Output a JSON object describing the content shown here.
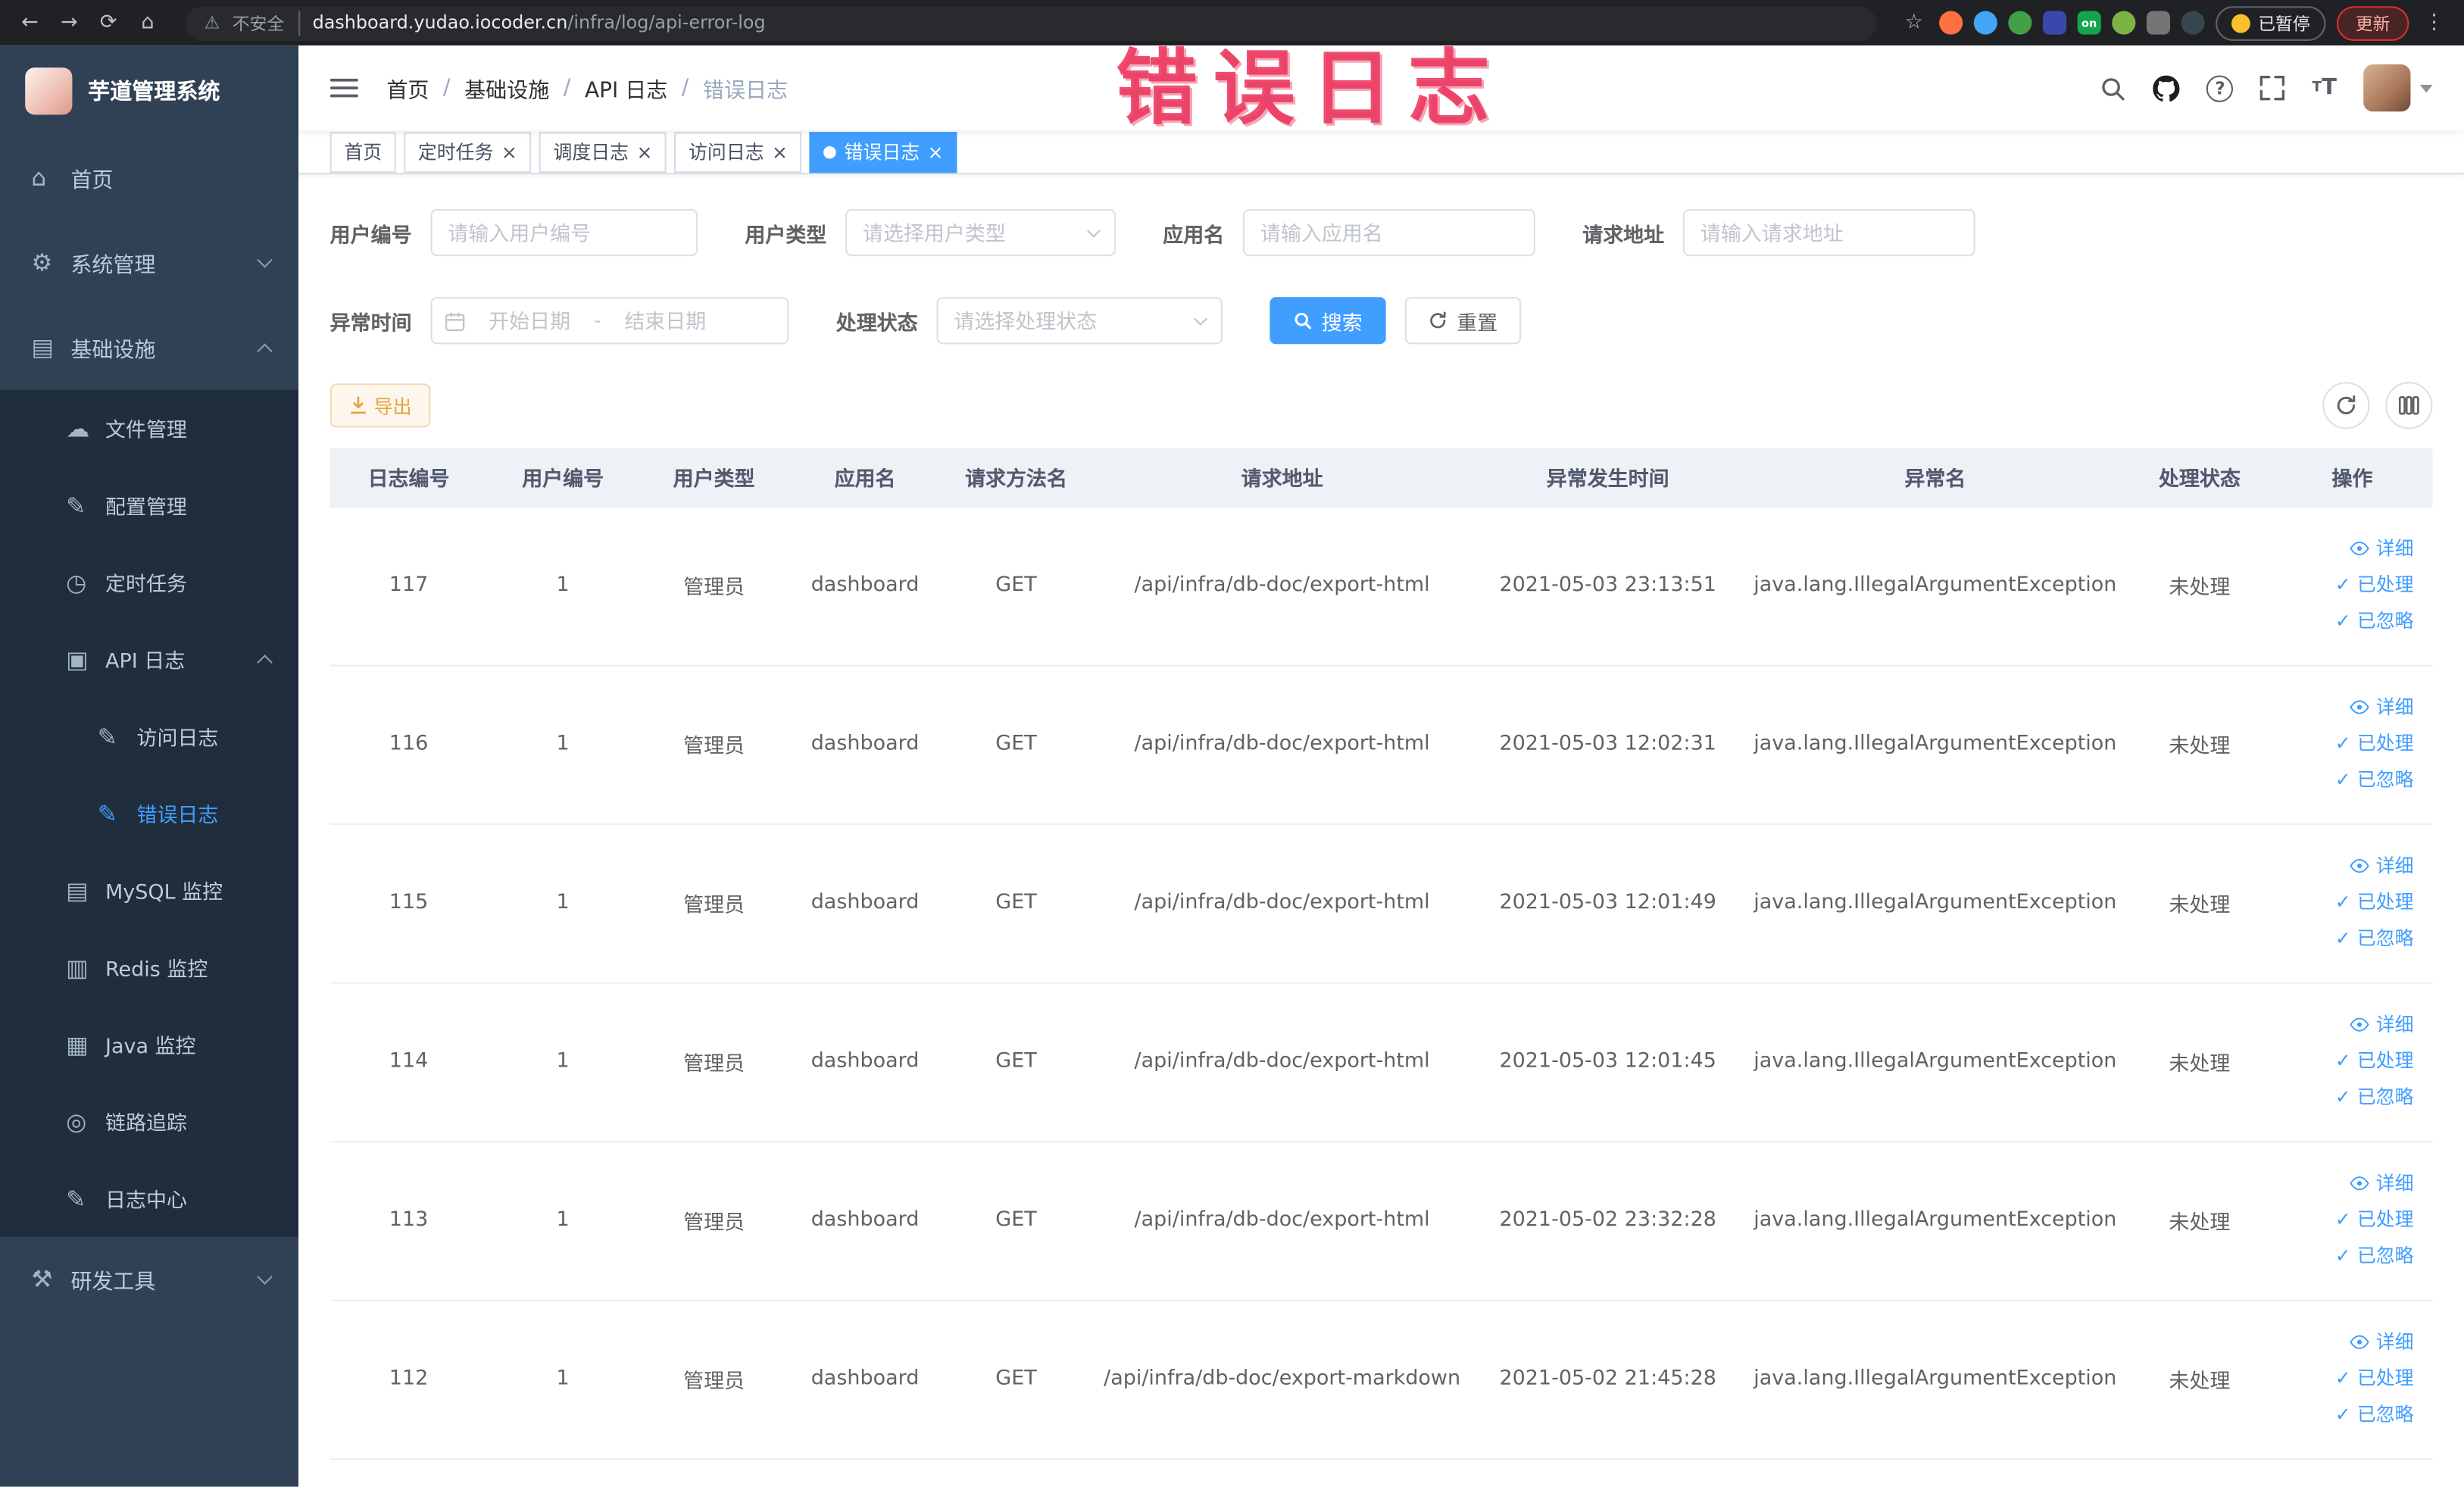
{
  "colors": {
    "accent": "#409EFF",
    "warning": "#E6A23C",
    "annotation_red": "#EA375E",
    "sidebar_bg": "#304156",
    "submenu_bg": "#1F2D3D",
    "table_header_bg": "#EEF1F6"
  },
  "icons": {
    "back": "←",
    "forward": "→",
    "reload": "⟳",
    "chrome_home": "⌂",
    "warning_triangle": "⚠",
    "star": "☆",
    "menu_dots": "⋮",
    "close": "×",
    "check": "✓",
    "question": "?",
    "font_size": "T",
    "home": "⌂",
    "gear": "⚙",
    "infra": "▤",
    "cloud": "☁",
    "edit": "✎",
    "clock": "◷",
    "doc": "▣",
    "layers": "▥",
    "monitor": "▦",
    "target": "◎",
    "tools": "⚒"
  },
  "browser": {
    "security_label": "不安全",
    "url_host": "dashboard.yudao.iocoder.cn",
    "url_path": "/infra/log/api-error-log",
    "extension_on_text": "on",
    "paused_badge": "已暂停",
    "update_label": "更新"
  },
  "annotation": {
    "text": "错误日志"
  },
  "sidebar": {
    "logo_title": "芋道管理系统",
    "items": {
      "home": "首页",
      "system": "系统管理",
      "infra": "基础设施",
      "file": "文件管理",
      "config": "配置管理",
      "job": "定时任务",
      "api_log": "API 日志",
      "access_log": "访问日志",
      "error_log": "错误日志",
      "mysql": "MySQL 监控",
      "redis": "Redis 监控",
      "java": "Java 监控",
      "trace": "链路追踪",
      "log_center": "日志中心",
      "dev_tools": "研发工具"
    }
  },
  "breadcrumb": {
    "separator": "/",
    "items": [
      "首页",
      "基础设施",
      "API 日志",
      "错误日志"
    ]
  },
  "tabs": [
    {
      "label": "首页"
    },
    {
      "label": "定时任务"
    },
    {
      "label": "调度日志"
    },
    {
      "label": "访问日志"
    },
    {
      "label": "错误日志"
    }
  ],
  "filters": {
    "user_id": {
      "label": "用户编号",
      "placeholder": "请输入用户编号"
    },
    "user_type": {
      "label": "用户类型",
      "placeholder": "请选择用户类型"
    },
    "app_name": {
      "label": "应用名",
      "placeholder": "请输入应用名"
    },
    "request_url": {
      "label": "请求地址",
      "placeholder": "请输入请求地址"
    },
    "exception_time": {
      "label": "异常时间",
      "start_placeholder": "开始日期",
      "separator": "-",
      "end_placeholder": "结束日期"
    },
    "process_status": {
      "label": "处理状态",
      "placeholder": "请选择处理状态"
    },
    "search_button": "搜索",
    "reset_button": "重置"
  },
  "toolbar": {
    "export_button": "导出"
  },
  "table": {
    "columns": [
      "日志编号",
      "用户编号",
      "用户类型",
      "应用名",
      "请求方法名",
      "请求地址",
      "异常发生时间",
      "异常名",
      "处理状态",
      "操作"
    ],
    "action_labels": {
      "detail": "详细",
      "process": "已处理",
      "ignore": "已忽略"
    },
    "rows": [
      {
        "log_id": "117",
        "user_id": "1",
        "user_type": "管理员",
        "app_name": "dashboard",
        "method": "GET",
        "url": "/api/infra/db-doc/export-html",
        "time": "2021-05-03 23:13:51",
        "exception": "java.lang.IllegalArgumentException",
        "status": "未处理"
      },
      {
        "log_id": "116",
        "user_id": "1",
        "user_type": "管理员",
        "app_name": "dashboard",
        "method": "GET",
        "url": "/api/infra/db-doc/export-html",
        "time": "2021-05-03 12:02:31",
        "exception": "java.lang.IllegalArgumentException",
        "status": "未处理"
      },
      {
        "log_id": "115",
        "user_id": "1",
        "user_type": "管理员",
        "app_name": "dashboard",
        "method": "GET",
        "url": "/api/infra/db-doc/export-html",
        "time": "2021-05-03 12:01:49",
        "exception": "java.lang.IllegalArgumentException",
        "status": "未处理"
      },
      {
        "log_id": "114",
        "user_id": "1",
        "user_type": "管理员",
        "app_name": "dashboard",
        "method": "GET",
        "url": "/api/infra/db-doc/export-html",
        "time": "2021-05-03 12:01:45",
        "exception": "java.lang.IllegalArgumentException",
        "status": "未处理"
      },
      {
        "log_id": "113",
        "user_id": "1",
        "user_type": "管理员",
        "app_name": "dashboard",
        "method": "GET",
        "url": "/api/infra/db-doc/export-html",
        "time": "2021-05-02 23:32:28",
        "exception": "java.lang.IllegalArgumentException",
        "status": "未处理"
      },
      {
        "log_id": "112",
        "user_id": "1",
        "user_type": "管理员",
        "app_name": "dashboard",
        "method": "GET",
        "url": "/api/infra/db-doc/export-markdown",
        "time": "2021-05-02 21:45:28",
        "exception": "java.lang.IllegalArgumentException",
        "status": "未处理"
      }
    ]
  }
}
